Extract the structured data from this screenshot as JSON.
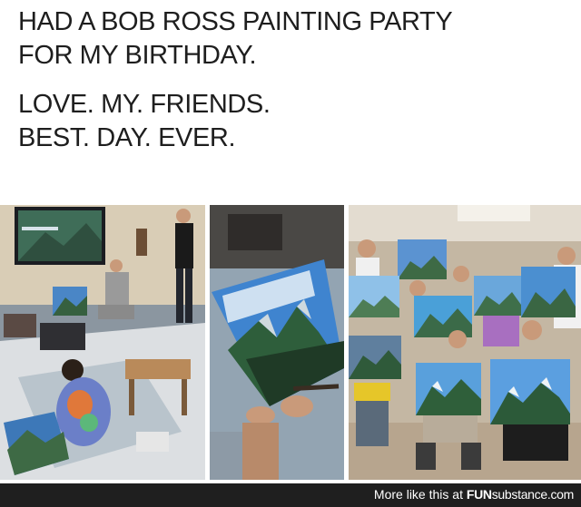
{
  "caption": {
    "line1": "HAD A BOB ROSS PAINTING PARTY",
    "line2": "FOR MY BIRTHDAY.",
    "line3": "LOVE. MY. FRIENDS.",
    "line4": "BEST. DAY. EVER."
  },
  "photos": [
    {
      "name": "party-room-photo"
    },
    {
      "name": "painting-closeup-photo"
    },
    {
      "name": "friends-holding-paintings-photo"
    }
  ],
  "footer": {
    "prefix": "More like this at ",
    "brand_fun": "FUN",
    "brand_sub": "substance",
    "brand_tld": ".com"
  },
  "colors": {
    "caption_text": "#1e1e1e",
    "footer_bg": "#1f1f1f",
    "footer_text": "#ffffff"
  }
}
